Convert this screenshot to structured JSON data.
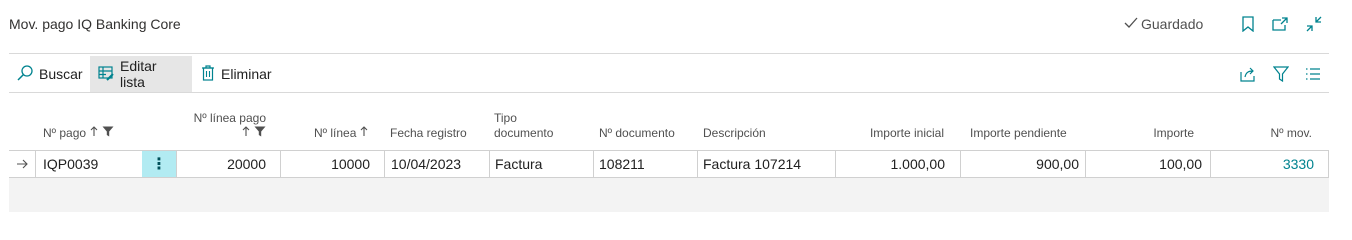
{
  "header": {
    "title": "Mov. pago IQ Banking Core",
    "status_label": "Guardado",
    "icons": [
      "check-icon",
      "bookmark-icon",
      "open-in-new-icon",
      "collapse-icon"
    ]
  },
  "toolbar": {
    "search_label": "Buscar",
    "edit_list_label": "Editar lista",
    "delete_label": "Eliminar",
    "right_icons": [
      "share-icon",
      "filter-icon",
      "list-view-icon"
    ]
  },
  "columns": {
    "payment_no": "Nº pago",
    "payment_line_no": "Nº línea pago",
    "line_no": "Nº línea",
    "posting_date": "Fecha registro",
    "doc_type_line1": "Tipo",
    "doc_type_line2": "documento",
    "doc_no": "Nº documento",
    "description": "Descripción",
    "initial_amount": "Importe inicial",
    "pending_amount": "Importe pendiente",
    "amount": "Importe",
    "entry_no": "Nº mov."
  },
  "row": {
    "payment_no": "IQP0039",
    "payment_line_no": "20000",
    "line_no": "10000",
    "posting_date": "10/04/2023",
    "doc_type": "Factura",
    "doc_no": "108211",
    "description": "Factura 107214",
    "initial_amount": "1.000,00",
    "pending_amount": "900,00",
    "amount": "100,00",
    "entry_no": "3330"
  },
  "colors": {
    "accent": "#00838f",
    "selected_cell": "#b2ebf2"
  }
}
